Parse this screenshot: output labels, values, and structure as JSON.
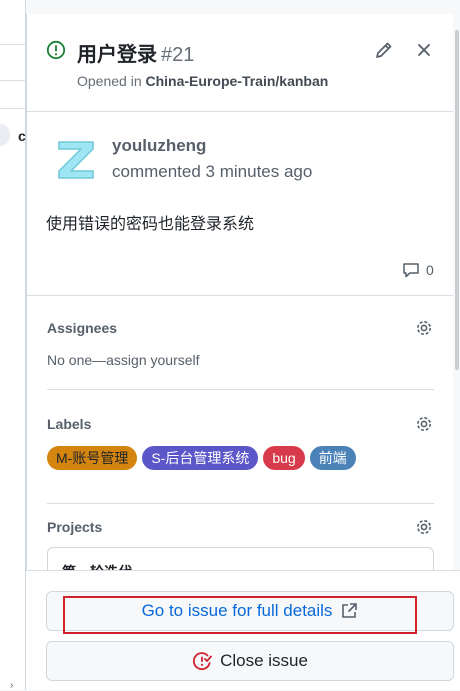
{
  "backdrop": {
    "fragment": "c",
    "chevron": "›"
  },
  "header": {
    "title": "用户登录",
    "issue_number": "#21",
    "opened_prefix": "Opened in ",
    "repo": "China-Europe-Train/kanban",
    "status_icon": "issue-opened-icon",
    "status_color": "#1a7f37"
  },
  "comment": {
    "author": "youluzheng",
    "time": "commented 3 minutes ago",
    "body": "使用错误的密码也能登录系统",
    "reply_count": "0"
  },
  "assignees": {
    "title": "Assignees",
    "value": "No one—assign yourself"
  },
  "labels": {
    "title": "Labels",
    "items": [
      {
        "name": "M-账号管理",
        "color": "#d4850f"
      },
      {
        "name": "S-后台管理系统",
        "color": "#5b57c9"
      },
      {
        "name": "bug",
        "color": "#d73a4a"
      },
      {
        "name": "前端",
        "color": "#4b82b8"
      }
    ]
  },
  "projects": {
    "title": "Projects",
    "item": "第一轮迭代"
  },
  "actions": {
    "goto_label": "Go to issue for full details",
    "close_label": "Close issue"
  },
  "colors": {
    "accent": "#0969da",
    "highlight": "#d0242b",
    "danger": "#cf222e"
  }
}
